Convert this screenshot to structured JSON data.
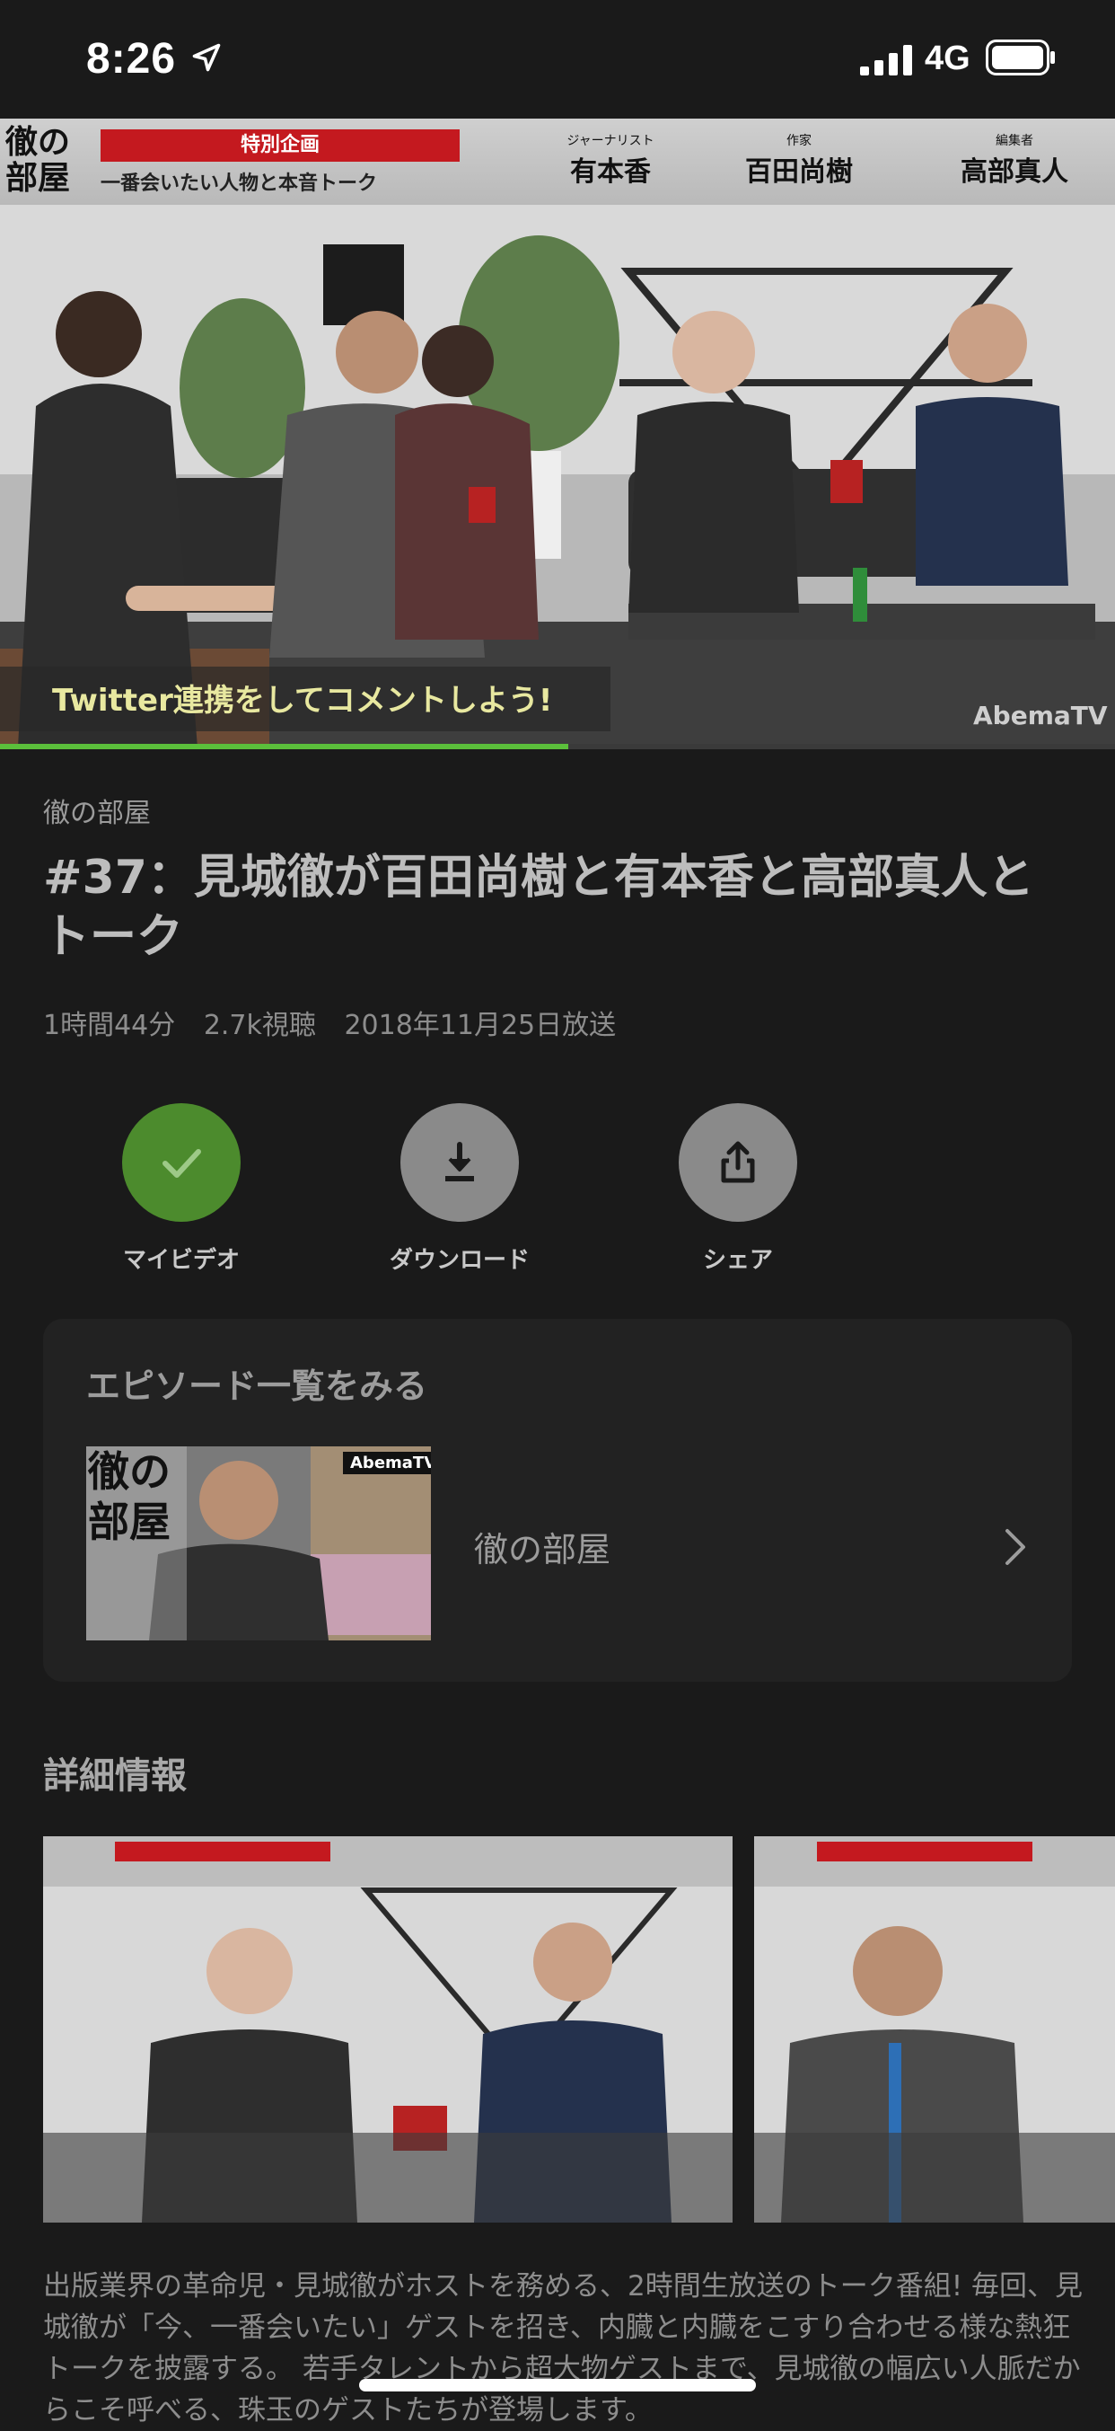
{
  "status_bar": {
    "time": "8:26",
    "network": "4G"
  },
  "video": {
    "banner": {
      "logo": "徹の部屋",
      "special": "特別企画",
      "subtitle": "一番会いたい人物と本音トーク",
      "guests": [
        {
          "role": "ジャーナリスト",
          "name": "有本香"
        },
        {
          "role": "作家",
          "name": "百田尚樹"
        },
        {
          "role": "編集者",
          "name": "高部真人"
        }
      ]
    },
    "caption": "Twitter連携をしてコメントしよう!",
    "watermark": "AbemaTV",
    "progress": 0.51
  },
  "program": {
    "channel": "徹の部屋",
    "title": "#37：見城徹が百田尚樹と有本香と高部真人とトーク",
    "meta": [
      "1時間44分",
      "2.7k視聴",
      "2018年11月25日放送"
    ]
  },
  "actions": [
    {
      "label": "マイビデオ",
      "icon": "check-icon",
      "active": true
    },
    {
      "label": "ダウンロード",
      "icon": "download-icon",
      "active": false
    },
    {
      "label": "シェア",
      "icon": "share-icon",
      "active": false
    }
  ],
  "episodes": {
    "heading": "エピソード一覧をみる",
    "series_title": "徹の部屋",
    "thumb_logo": "徹の部屋",
    "thumb_badge": "AbemaTV"
  },
  "detail": {
    "heading": "詳細情報",
    "description": "出版業界の革命児・見城徹がホストを務める、2時間生放送のトーク番組! 毎回、見城徹が「今、一番会いたい」ゲストを招き、内臓と内臓をこすり合わせる様な熱狂トークを披露する。 若手タレントから超大物ゲストまで、見城徹の幅広い人脈だからこそ呼べる、珠玉のゲストたちが登場します。"
  },
  "colors": {
    "accent": "#4c8b2d",
    "progress": "#5bbf3b",
    "background": "#1a1a1a"
  }
}
